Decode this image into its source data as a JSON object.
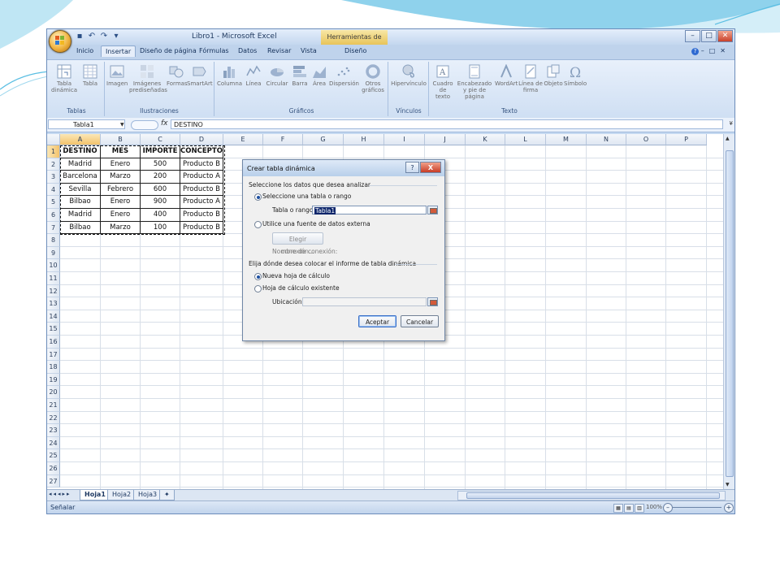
{
  "window": {
    "title": "Libro1 - Microsoft Excel",
    "contextual_tools": "Herramientas de tabla"
  },
  "ribbon_tabs": [
    "Inicio",
    "Insertar",
    "Diseño de página",
    "Fórmulas",
    "Datos",
    "Revisar",
    "Vista",
    "Diseño"
  ],
  "active_tab": "Insertar",
  "ribbon_groups": [
    {
      "label": "Tablas",
      "buttons": [
        "Tabla dinámica",
        "Tabla"
      ]
    },
    {
      "label": "Ilustraciones",
      "buttons": [
        "Imagen",
        "Imágenes prediseñadas",
        "Formas",
        "SmartArt"
      ]
    },
    {
      "label": "Gráficos",
      "buttons": [
        "Columna",
        "Línea",
        "Circular",
        "Barra",
        "Área",
        "Dispersión",
        "Otros gráficos"
      ]
    },
    {
      "label": "Vínculos",
      "buttons": [
        "Hipervínculo"
      ]
    },
    {
      "label": "Texto",
      "buttons": [
        "Cuadro de texto",
        "Encabezado y pie de página",
        "WordArt",
        "Línea de firma",
        "Objeto",
        "Símbolo"
      ]
    }
  ],
  "formula_bar": {
    "name_box": "Tabla1",
    "fx": "fx",
    "content": "DESTINO"
  },
  "columns": [
    "A",
    "B",
    "C",
    "D",
    "E",
    "F",
    "G",
    "H",
    "I",
    "J",
    "K",
    "L",
    "M",
    "N",
    "O",
    "P"
  ],
  "rows": [
    "1",
    "2",
    "3",
    "4",
    "5",
    "6",
    "7",
    "8",
    "9",
    "10",
    "11",
    "12",
    "13",
    "14",
    "15",
    "16",
    "17",
    "18",
    "19",
    "20",
    "21",
    "22",
    "23",
    "24",
    "25",
    "26",
    "27"
  ],
  "table": {
    "headers": [
      "DESTINO",
      "MES",
      "IMPORTE",
      "CONCEPTO"
    ],
    "data": [
      [
        "Madrid",
        "Enero",
        "500",
        "Producto B"
      ],
      [
        "Barcelona",
        "Marzo",
        "200",
        "Producto A"
      ],
      [
        "Sevilla",
        "Febrero",
        "600",
        "Producto B"
      ],
      [
        "Bilbao",
        "Enero",
        "900",
        "Producto A"
      ],
      [
        "Madrid",
        "Enero",
        "400",
        "Producto B"
      ],
      [
        "Bilbao",
        "Marzo",
        "100",
        "Producto B"
      ]
    ]
  },
  "sheets": [
    "Hoja1",
    "Hoja2",
    "Hoja3"
  ],
  "active_sheet": "Hoja1",
  "status": "Señalar",
  "zoom": "100%",
  "dialog": {
    "title": "Crear tabla dinámica",
    "help": "?",
    "close": "X",
    "section1": "Seleccione los datos que desea analizar",
    "radio_select_range": "Seleccione una tabla o rango",
    "table_range_label": "Tabla o rango:",
    "table_range_value": "Tabla1",
    "radio_external": "Utilice una fuente de datos externa",
    "choose_connection": "Elegir conexión...",
    "connection_name_label": "Nombre de conexión:",
    "section2": "Elija dónde desea colocar el informe de tabla dinámica",
    "radio_new_sheet": "Nueva hoja de cálculo",
    "radio_existing_sheet": "Hoja de cálculo existente",
    "location_label": "Ubicación:",
    "location_value": "",
    "ok": "Aceptar",
    "cancel": "Cancelar"
  }
}
